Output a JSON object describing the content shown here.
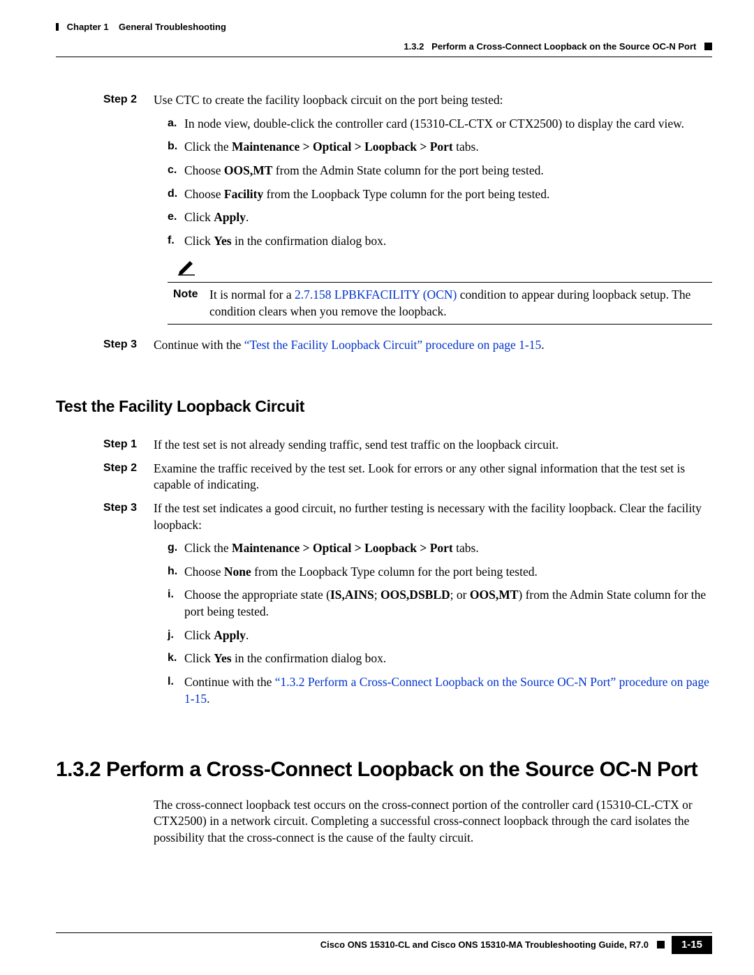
{
  "header": {
    "left_chapter": "Chapter 1",
    "left_title": "General Troubleshooting",
    "right_section": "1.3.2",
    "right_title": "Perform a Cross-Connect Loopback on the Source OC-N Port"
  },
  "block1": {
    "step2_label": "Step 2",
    "step2_text": "Use CTC to create the facility loopback circuit on the port being tested:",
    "a_l": "a.",
    "a_t": "In node view, double-click the controller card (15310-CL-CTX or CTX2500) to display the card view.",
    "b_l": "b.",
    "b_t_pre": "Click the ",
    "b_t_bold": "Maintenance > Optical > Loopback > Port",
    "b_t_post": " tabs.",
    "c_l": "c.",
    "c_t_pre": "Choose ",
    "c_t_bold": "OOS,MT",
    "c_t_post": " from the Admin State column for the port being tested.",
    "d_l": "d.",
    "d_t_pre": "Choose ",
    "d_t_bold": "Facility",
    "d_t_post": " from the Loopback Type column for the port being tested.",
    "e_l": "e.",
    "e_t_pre": "Click ",
    "e_t_bold": "Apply",
    "e_t_post": ".",
    "f_l": "f.",
    "f_t_pre": "Click ",
    "f_t_bold": "Yes",
    "f_t_post": " in the confirmation dialog box.",
    "note_label": "Note",
    "note_pre": "It is normal for a ",
    "note_link": "2.7.158  LPBKFACILITY (OCN)",
    "note_post": " condition to appear during loopback setup. The condition clears when you remove the loopback.",
    "step3_label": "Step 3",
    "step3_pre": "Continue with the ",
    "step3_link": "“Test the Facility Loopback Circuit” procedure on page 1-15",
    "step3_post": "."
  },
  "block2": {
    "heading": "Test the Facility Loopback Circuit",
    "step1_label": "Step 1",
    "step1_text": "If the test set is not already sending traffic, send test traffic on the loopback circuit.",
    "step2_label": "Step 2",
    "step2_text": "Examine the traffic received by the test set. Look for errors or any other signal information that the test set is capable of indicating.",
    "step3_label": "Step 3",
    "step3_text": "If the test set indicates a good circuit, no further testing is necessary with the facility loopback. Clear the facility loopback:",
    "g_l": "g.",
    "g_t_pre": "Click the ",
    "g_t_bold": "Maintenance > Optical > Loopback > Port",
    "g_t_post": " tabs.",
    "h_l": "h.",
    "h_t_pre": "Choose ",
    "h_t_bold": "None",
    "h_t_post": " from the Loopback Type column for the port being tested.",
    "i_l": "i.",
    "i_t_pre": "Choose the appropriate state (",
    "i_t_b1": "IS,AINS",
    "i_t_m1": "; ",
    "i_t_b2": "OOS,DSBLD",
    "i_t_m2": "; or ",
    "i_t_b3": "OOS,MT",
    "i_t_post": ") from the Admin State column for the port being tested.",
    "j_l": "j.",
    "j_t_pre": "Click ",
    "j_t_bold": "Apply",
    "j_t_post": ".",
    "k_l": "k.",
    "k_t_pre": "Click ",
    "k_t_bold": "Yes",
    "k_t_post": " in the confirmation dialog box.",
    "l_l": "l.",
    "l_t_pre": "Continue with the ",
    "l_t_link": "“1.3.2  Perform a Cross-Connect Loopback on the Source OC-N Port” procedure on page 1-15",
    "l_t_post": "."
  },
  "block3": {
    "heading": "1.3.2  Perform a Cross-Connect Loopback on the Source OC-N Port",
    "para": "The cross-connect loopback test occurs on the cross-connect portion of the controller card (15310-CL-CTX or CTX2500) in a network circuit. Completing a successful cross-connect loopback through the card isolates the possibility that the cross-connect is the cause of the faulty circuit."
  },
  "footer": {
    "title": "Cisco ONS 15310-CL and Cisco ONS 15310-MA Troubleshooting Guide, R7.0",
    "page": "1-15"
  }
}
